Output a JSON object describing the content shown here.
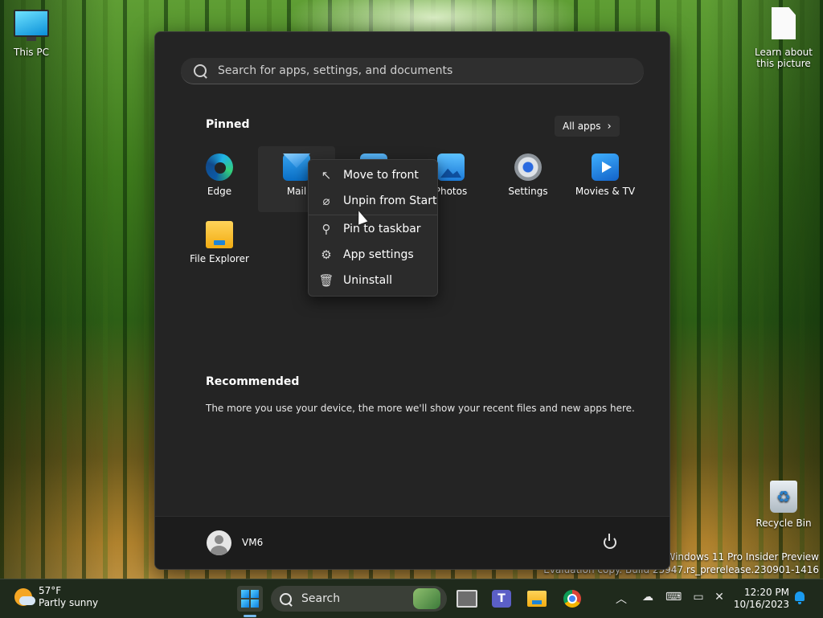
{
  "desktop": {
    "icons": [
      {
        "label": "This PC"
      },
      {
        "label": "Learn about this picture"
      },
      {
        "label": "Recycle Bin"
      }
    ],
    "watermark": {
      "line1": "Windows 11 Pro Insider Preview",
      "line2": "Evaluation copy. Build 25947.rs_prerelease.230901-1416"
    }
  },
  "start_menu": {
    "search_placeholder": "Search for apps, settings, and documents",
    "pinned_title": "Pinned",
    "all_apps_label": "All apps",
    "pinned_apps": [
      {
        "label": "Edge",
        "icon": "edge-icon"
      },
      {
        "label": "Mail",
        "icon": "mail-icon"
      },
      {
        "label": "",
        "icon": "store-icon"
      },
      {
        "label": "Photos",
        "icon": "photos-icon"
      },
      {
        "label": "Settings",
        "icon": "settings-icon"
      },
      {
        "label": "Movies & TV",
        "icon": "movies-tv-icon"
      },
      {
        "label": "File Explorer",
        "icon": "file-explorer-icon"
      }
    ],
    "recommended_title": "Recommended",
    "recommended_text": "The more you use your device, the more we'll show your recent files and new apps here.",
    "user_name": "VM6"
  },
  "context_menu": {
    "items": [
      {
        "label": "Move to front",
        "icon": "move-to-front-icon"
      },
      {
        "label": "Unpin from Start",
        "icon": "unpin-icon"
      },
      {
        "label": "Pin to taskbar",
        "icon": "pin-icon"
      },
      {
        "label": "App settings",
        "icon": "gear-icon"
      },
      {
        "label": "Uninstall",
        "icon": "trash-icon"
      }
    ]
  },
  "taskbar": {
    "weather": {
      "temp": "57°F",
      "condition": "Partly sunny"
    },
    "search_label": "Search",
    "clock": {
      "time": "12:20 PM",
      "date": "10/16/2023"
    }
  }
}
